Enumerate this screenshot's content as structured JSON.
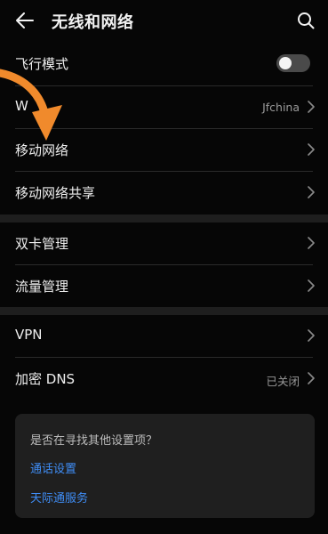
{
  "header": {
    "title": "无线和网络"
  },
  "rows": {
    "airplane": {
      "label": "飞行模式",
      "toggle_on": false
    },
    "wlan": {
      "label": "W",
      "value": "Jfchina"
    },
    "mobile_network": {
      "label": "移动网络"
    },
    "hotspot": {
      "label": "移动网络共享"
    },
    "dual_sim": {
      "label": "双卡管理"
    },
    "data_usage": {
      "label": "流量管理"
    },
    "vpn": {
      "label": "VPN"
    },
    "private_dns": {
      "label": "加密 DNS",
      "value": "已关闭"
    }
  },
  "card": {
    "title": "是否在寻找其他设置项？",
    "links": [
      "通话设置",
      "天际通服务"
    ]
  },
  "colors": {
    "background": "#060606",
    "link": "#3f8df5",
    "overlay_arrow": "#f08a2c"
  },
  "icons": {
    "back": "arrow-left-icon",
    "search": "search-icon",
    "chevron": "chevron-right-icon"
  }
}
